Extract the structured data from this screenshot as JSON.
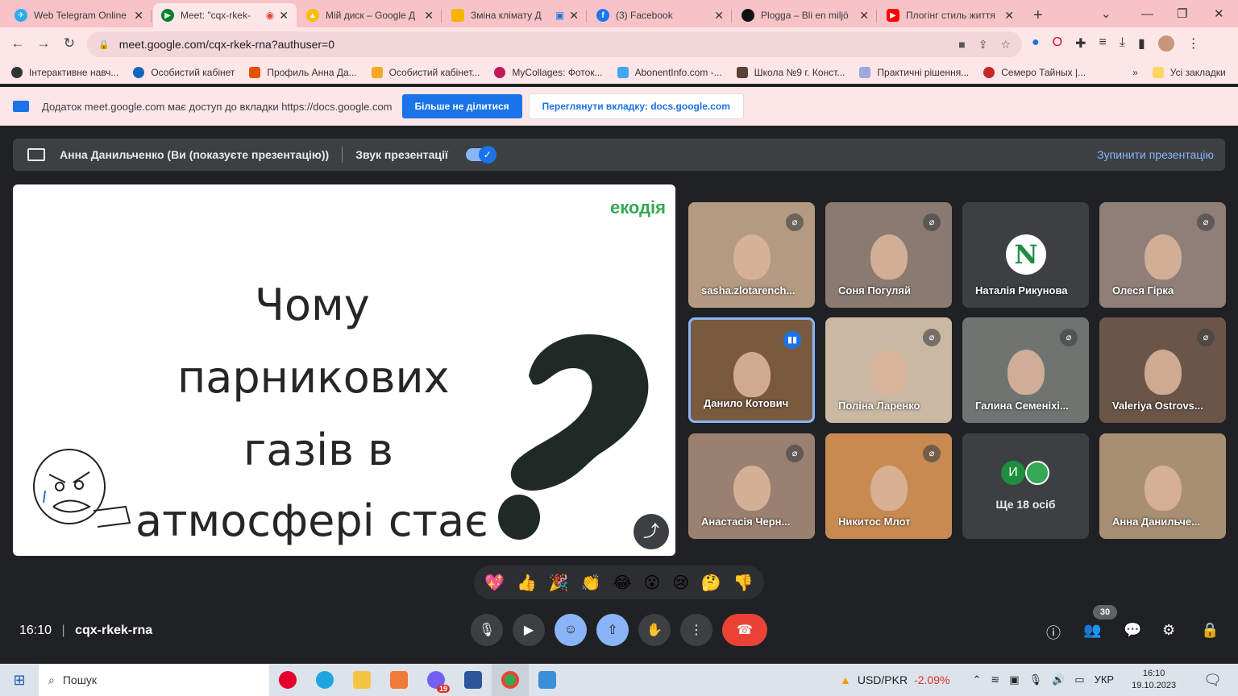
{
  "browser": {
    "tabs": [
      {
        "title": "Web Telegram Online",
        "color": "#2aabee",
        "active": false
      },
      {
        "title": "Meet: \"cqx-rkek-",
        "color": "#00832d",
        "active": true
      },
      {
        "title": "Мій диск – Google Д",
        "color": "#fbbc04",
        "active": false
      },
      {
        "title": "Зміна клімату Д",
        "color": "#f4b400",
        "active": false
      },
      {
        "title": "(3) Facebook",
        "color": "#1877f2",
        "active": false
      },
      {
        "title": "Plogga – Bli en miljö",
        "color": "#111111",
        "active": false
      },
      {
        "title": "Плогінг стиль життя",
        "color": "#ff0000",
        "active": false
      }
    ],
    "new_tab": "+",
    "address": "meet.google.com/cqx-rkek-rna?authuser=0",
    "bookmarks": [
      "Інтерактивне навч...",
      "Особистий кабінет",
      "Профиль Анна Да...",
      "Особистий кабінет...",
      "MyCollages: Фоток...",
      "AbonentInfo.com -...",
      "Школа №9 г. Конст...",
      "Практичні рішення...",
      "Семеро Тайных |..."
    ],
    "bookmarks_more": "»",
    "all_bookmarks": "Усі закладки",
    "infobar": {
      "text": "Додаток meet.google.com має доступ до вкладки https://docs.google.com",
      "stop_share": "Більше не ділитися",
      "view_tab": "Переглянути вкладку: docs.google.com"
    }
  },
  "meet": {
    "presenting_label": "Анна Данильченко (Ви (показуєте презентацію))",
    "audio_label": "Звук презентації",
    "stop_presenting": "Зупинити презентацію",
    "slide": {
      "logo": "екодія",
      "lines": [
        "Чому",
        "парникових",
        "газів в",
        "атмосфері  стає"
      ]
    },
    "participants": [
      {
        "name": "sasha.zlotarench...",
        "muted": true,
        "bg": "#b39a80"
      },
      {
        "name": "Соня Погуляй",
        "muted": true,
        "bg": "#8a7a70"
      },
      {
        "name": "Наталія Рикунова",
        "muted": false,
        "bg": "#3c4043",
        "avatar": "N"
      },
      {
        "name": "Олеся Гірка",
        "muted": true,
        "bg": "#8f7f78"
      },
      {
        "name": "Данило Котович",
        "muted": false,
        "bg": "#7a5a3e",
        "speaking": true
      },
      {
        "name": "Поліна Ларенко",
        "muted": true,
        "bg": "#c9b9a2"
      },
      {
        "name": "Галина Семеніхі...",
        "muted": true,
        "bg": "#6f7470"
      },
      {
        "name": "Valeriya Ostrovs...",
        "muted": true,
        "bg": "#6b5548"
      },
      {
        "name": "Анастасія Черн...",
        "muted": true,
        "bg": "#9a8070"
      },
      {
        "name": "Никитос Млот",
        "muted": true,
        "bg": "#c88a50"
      },
      {
        "name": "Ще 18 осіб",
        "muted": false,
        "bg": "#3c4043",
        "more": true,
        "initial": "И"
      },
      {
        "name": "Анна Данильче...",
        "muted": false,
        "bg": "#a88f74"
      }
    ],
    "reactions": [
      "💖",
      "👍",
      "🎉",
      "👏",
      "😂",
      "😮",
      "😢",
      "🤔",
      "👎"
    ],
    "time": "16:10",
    "meeting_code": "cqx-rkek-rna",
    "people_count": "30"
  },
  "taskbar": {
    "search": "Пошук",
    "ticker": "USD/PKR",
    "ticker_change": "-2.09%",
    "lang": "УКР",
    "clock_time": "16:10",
    "clock_date": "19.10.2023",
    "word_badge": "19"
  }
}
